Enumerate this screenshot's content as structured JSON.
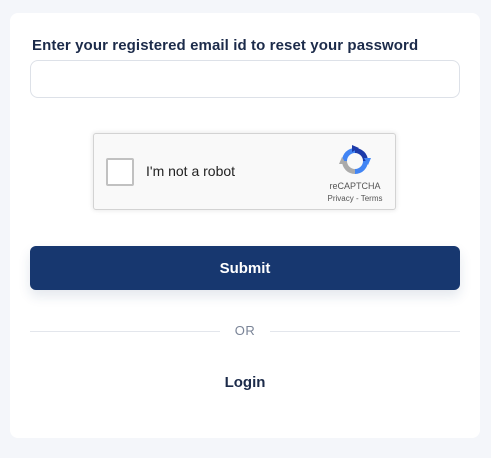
{
  "form": {
    "label": "Enter your registered email id to reset your password",
    "email_value": "",
    "email_placeholder": ""
  },
  "recaptcha": {
    "checkbox_label": "I'm not a robot",
    "brand": "reCAPTCHA",
    "privacy": "Privacy",
    "separator": " - ",
    "terms": "Terms",
    "checked": false,
    "logo_icon": "recaptcha-logo-icon"
  },
  "actions": {
    "submit_label": "Submit",
    "divider_text": "OR",
    "login_label": "Login"
  },
  "colors": {
    "background": "#f4f6fa",
    "card": "#ffffff",
    "primary_button": "#17376f",
    "heading_text": "#1c2b4a",
    "divider_text": "#7a8497"
  }
}
